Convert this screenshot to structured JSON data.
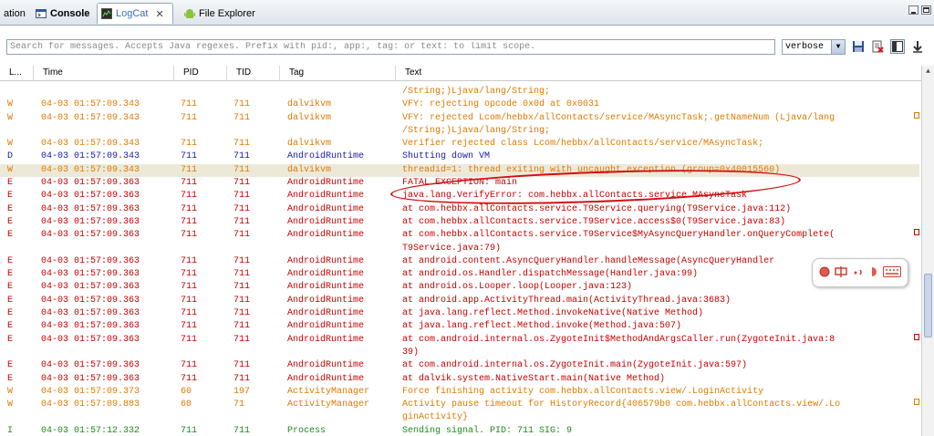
{
  "tabs": [
    {
      "label": "ation"
    },
    {
      "label": "Console"
    },
    {
      "label": "LogCat",
      "close": "✕"
    },
    {
      "label": "File Explorer"
    }
  ],
  "search": {
    "placeholder": "Search for messages. Accepts Java regexes. Prefix with pid:, app:, tag: or text: to limit scope."
  },
  "level_select": {
    "value": "verbose"
  },
  "columns": [
    "L...",
    "Time",
    "PID",
    "TID",
    "Tag",
    "Text"
  ],
  "colors": {
    "W": "#e07a00",
    "D": "#1a1aa8",
    "E": "#c80000",
    "I": "#1c8c1c",
    "annotation": "#d01010"
  },
  "rows": [
    {
      "level": "",
      "time": "",
      "pid": "",
      "tid": "",
      "tag": "",
      "text": "/String;)Ljava/lang/String;",
      "cls": "W",
      "trunc": false
    },
    {
      "level": "W",
      "time": "04-03 01:57:09.343",
      "pid": "711",
      "tid": "711",
      "tag": "dalvikvm",
      "text": "VFY:  rejecting opcode 0x0d at 0x0031",
      "cls": "W",
      "trunc": false
    },
    {
      "level": "W",
      "time": "04-03 01:57:09.343",
      "pid": "711",
      "tid": "711",
      "tag": "dalvikvm",
      "text": "VFY:  rejected Lcom/hebbx/allContacts/service/MAsyncTask;.getNameNum (Ljava/lang",
      "cls": "W",
      "trunc": true
    },
    {
      "level": "",
      "time": "",
      "pid": "",
      "tid": "",
      "tag": "",
      "text": "/String;)Ljava/lang/String;",
      "cls": "W",
      "trunc": false
    },
    {
      "level": "W",
      "time": "04-03 01:57:09.343",
      "pid": "711",
      "tid": "711",
      "tag": "dalvikvm",
      "text": "Verifier rejected class Lcom/hebbx/allContacts/service/MAsyncTask;",
      "cls": "W",
      "trunc": false
    },
    {
      "level": "D",
      "time": "04-03 01:57:09.343",
      "pid": "711",
      "tid": "711",
      "tag": "AndroidRuntime",
      "text": "Shutting down VM",
      "cls": "D",
      "trunc": false
    },
    {
      "level": "W",
      "time": "04-03 01:57:09.343",
      "pid": "711",
      "tid": "711",
      "tag": "dalvikvm",
      "text": "threadid=1: thread exiting with uncaught exception (group=0x40015560)",
      "cls": "W",
      "trunc": false,
      "hl": true
    },
    {
      "level": "E",
      "time": "04-03 01:57:09.363",
      "pid": "711",
      "tid": "711",
      "tag": "AndroidRuntime",
      "text": "FATAL EXCEPTION: main",
      "cls": "E",
      "trunc": false
    },
    {
      "level": "E",
      "time": "04-03 01:57:09.363",
      "pid": "711",
      "tid": "711",
      "tag": "AndroidRuntime",
      "text": "java.lang.VerifyError: com.hebbx.allContacts.service.MAsyncTask",
      "cls": "E",
      "trunc": false
    },
    {
      "level": "E",
      "time": "04-03 01:57:09.363",
      "pid": "711",
      "tid": "711",
      "tag": "AndroidRuntime",
      "text": "at com.hebbx.allContacts.service.T9Service.querying(T9Service.java:112)",
      "cls": "E",
      "trunc": false
    },
    {
      "level": "E",
      "time": "04-03 01:57:09.363",
      "pid": "711",
      "tid": "711",
      "tag": "AndroidRuntime",
      "text": "at com.hebbx.allContacts.service.T9Service.access$0(T9Service.java:83)",
      "cls": "E",
      "trunc": false
    },
    {
      "level": "E",
      "time": "04-03 01:57:09.363",
      "pid": "711",
      "tid": "711",
      "tag": "AndroidRuntime",
      "text": "at com.hebbx.allContacts.service.T9Service$MyAsyncQueryHandler.onQueryComplete(",
      "cls": "E",
      "trunc": true
    },
    {
      "level": "",
      "time": "",
      "pid": "",
      "tid": "",
      "tag": "",
      "text": "T9Service.java:79)",
      "cls": "E",
      "trunc": false
    },
    {
      "level": "E",
      "time": "04-03 01:57:09.363",
      "pid": "711",
      "tid": "711",
      "tag": "AndroidRuntime",
      "text": "at android.content.AsyncQueryHandler.handleMessage(AsyncQueryHandler",
      "cls": "E",
      "trunc": false
    },
    {
      "level": "E",
      "time": "04-03 01:57:09.363",
      "pid": "711",
      "tid": "711",
      "tag": "AndroidRuntime",
      "text": "at android.os.Handler.dispatchMessage(Handler.java:99)",
      "cls": "E",
      "trunc": false
    },
    {
      "level": "E",
      "time": "04-03 01:57:09.363",
      "pid": "711",
      "tid": "711",
      "tag": "AndroidRuntime",
      "text": "at android.os.Looper.loop(Looper.java:123)",
      "cls": "E",
      "trunc": false
    },
    {
      "level": "E",
      "time": "04-03 01:57:09.363",
      "pid": "711",
      "tid": "711",
      "tag": "AndroidRuntime",
      "text": "at android.app.ActivityThread.main(ActivityThread.java:3683)",
      "cls": "E",
      "trunc": false
    },
    {
      "level": "E",
      "time": "04-03 01:57:09.363",
      "pid": "711",
      "tid": "711",
      "tag": "AndroidRuntime",
      "text": "at java.lang.reflect.Method.invokeNative(Native Method)",
      "cls": "E",
      "trunc": false
    },
    {
      "level": "E",
      "time": "04-03 01:57:09.363",
      "pid": "711",
      "tid": "711",
      "tag": "AndroidRuntime",
      "text": "at java.lang.reflect.Method.invoke(Method.java:507)",
      "cls": "E",
      "trunc": false
    },
    {
      "level": "E",
      "time": "04-03 01:57:09.363",
      "pid": "711",
      "tid": "711",
      "tag": "AndroidRuntime",
      "text": "at com.android.internal.os.ZygoteInit$MethodAndArgsCaller.run(ZygoteInit.java:8",
      "cls": "E",
      "trunc": true
    },
    {
      "level": "",
      "time": "",
      "pid": "",
      "tid": "",
      "tag": "",
      "text": "39)",
      "cls": "E",
      "trunc": false
    },
    {
      "level": "E",
      "time": "04-03 01:57:09.363",
      "pid": "711",
      "tid": "711",
      "tag": "AndroidRuntime",
      "text": "at com.android.internal.os.ZygoteInit.main(ZygoteInit.java:597)",
      "cls": "E",
      "trunc": false
    },
    {
      "level": "E",
      "time": "04-03 01:57:09.363",
      "pid": "711",
      "tid": "711",
      "tag": "AndroidRuntime",
      "text": "at dalvik.system.NativeStart.main(Native Method)",
      "cls": "E",
      "trunc": false
    },
    {
      "level": "W",
      "time": "04-03 01:57:09.373",
      "pid": "60",
      "tid": "197",
      "tag": "ActivityManager",
      "text": "  Force finishing activity com.hebbx.allContacts.view/.LoginActivity",
      "cls": "W",
      "trunc": false
    },
    {
      "level": "W",
      "time": "04-03 01:57:09.883",
      "pid": "60",
      "tid": "71",
      "tag": "ActivityManager",
      "text": "Activity pause timeout for HistoryRecord{406579b0 com.hebbx.allContacts.view/.Lo",
      "cls": "W",
      "trunc": true
    },
    {
      "level": "",
      "time": "",
      "pid": "",
      "tid": "",
      "tag": "",
      "text": "ginActivity}",
      "cls": "W",
      "trunc": false
    },
    {
      "level": "I",
      "time": "04-03 01:57:12.332",
      "pid": "711",
      "tid": "711",
      "tag": "Process",
      "text": "Sending signal. PID: 711 SIG: 9",
      "cls": "I",
      "trunc": false
    }
  ]
}
